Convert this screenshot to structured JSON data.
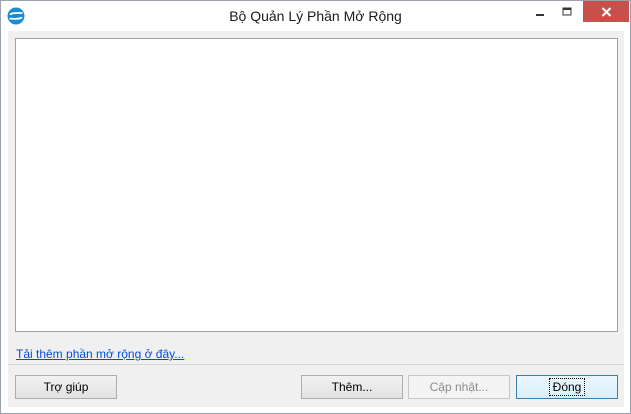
{
  "window": {
    "title": "Bộ Quản Lý Phần Mở Rộng",
    "icon": "app-logo-icon",
    "controls": [
      "minimize-icon",
      "maximize-icon",
      "close-icon"
    ]
  },
  "content": {
    "get_more_link": "Tải thêm phần mở rộng ở đây..."
  },
  "buttons": {
    "help": "Trợ giúp",
    "add": "Thêm...",
    "update": "Cập nhật...",
    "close": "Đóng"
  },
  "colors": {
    "close_button": "#c7504a",
    "link": "#0a4ad0",
    "default_button_border": "#3c7fb1"
  }
}
